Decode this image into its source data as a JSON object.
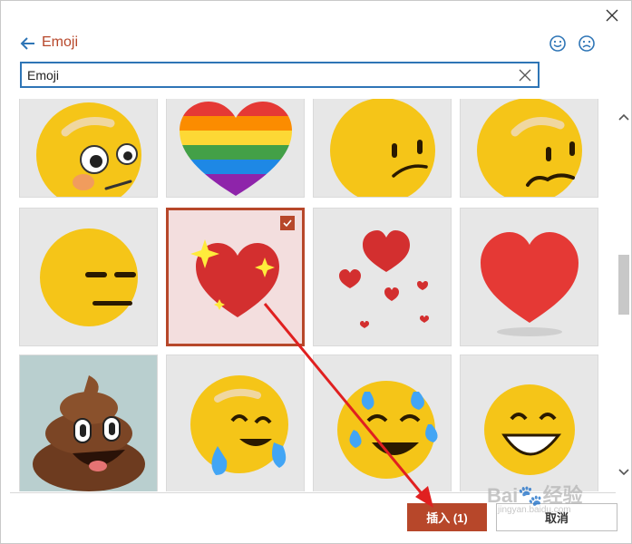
{
  "header": {
    "title": "Emoji"
  },
  "search": {
    "value": "Emoji"
  },
  "icons": {
    "close": "close-icon",
    "back": "arrow-left-icon",
    "happy": "smiley-face-icon",
    "sad": "sad-face-icon",
    "clear": "clear-icon"
  },
  "tiles": [
    {
      "name": "flushed-face"
    },
    {
      "name": "rainbow-heart"
    },
    {
      "name": "confused-face"
    },
    {
      "name": "face-with-mustache"
    },
    {
      "name": "expressionless-face"
    },
    {
      "name": "sparkling-heart",
      "selected": true
    },
    {
      "name": "floating-hearts"
    },
    {
      "name": "red-heart"
    },
    {
      "name": "pile-of-poo"
    },
    {
      "name": "crying-laughing-face"
    },
    {
      "name": "tears-of-joy-face"
    },
    {
      "name": "grinning-face"
    }
  ],
  "footer": {
    "insert_label": "插入 (1)",
    "cancel_label": "取消"
  },
  "watermark": {
    "main": "Bai🐾经验",
    "sub": "jingyan.baidu.com"
  },
  "colors": {
    "accent": "#b7472a",
    "focus": "#2e75b6",
    "arrow": "#e02020"
  }
}
